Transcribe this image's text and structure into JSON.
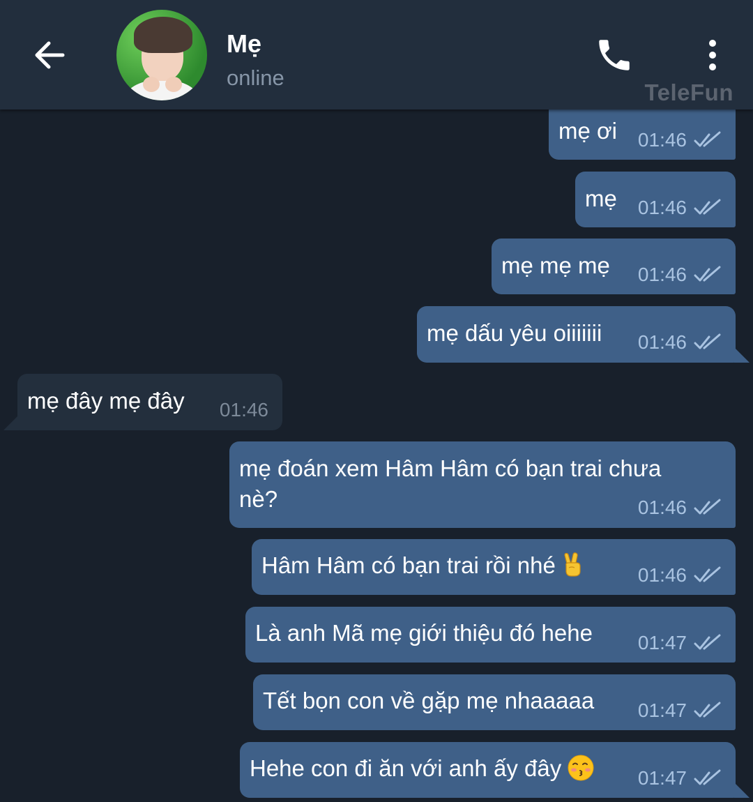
{
  "header": {
    "contact_name": "Mẹ",
    "status": "online",
    "watermark": "TeleFun"
  },
  "colors": {
    "background": "#18202b",
    "header": "#222e3d",
    "outgoing_bubble": "#3f6088",
    "incoming_bubble": "#232f3d",
    "read_ticks": "#a9c3e1"
  },
  "icons": {
    "back": "arrow-left-icon",
    "call": "phone-icon",
    "menu": "more-vertical-icon",
    "read_status": "double-check-icon"
  },
  "messages": [
    {
      "direction": "outgoing",
      "text": "mẹ ơi",
      "time": "01:46"
    },
    {
      "direction": "outgoing",
      "text": "mẹ",
      "time": "01:46"
    },
    {
      "direction": "outgoing",
      "text": "mẹ mẹ mẹ",
      "time": "01:46"
    },
    {
      "direction": "outgoing",
      "text": "mẹ dấu yêu oiiiiiii",
      "time": "01:46"
    },
    {
      "direction": "incoming",
      "text": "mẹ đây mẹ đây",
      "time": "01:46"
    },
    {
      "direction": "outgoing",
      "text_line1": "mẹ đoán xem Hâm Hâm có bạn trai chưa",
      "text_line2": "nè?",
      "time": "01:46"
    },
    {
      "direction": "outgoing",
      "text": "Hâm Hâm có bạn trai rồi nhé",
      "emoji": "victory-hand-emoji",
      "time": "01:46"
    },
    {
      "direction": "outgoing",
      "text": "Là anh Mã mẹ giới thiệu đó hehe",
      "time": "01:47"
    },
    {
      "direction": "outgoing",
      "text": "Tết bọn con về gặp mẹ nhaaaaa",
      "time": "01:47"
    },
    {
      "direction": "outgoing",
      "text": "Hehe con đi ăn với anh ấy đây",
      "emoji": "kissing-face-emoji",
      "time": "01:47"
    }
  ]
}
